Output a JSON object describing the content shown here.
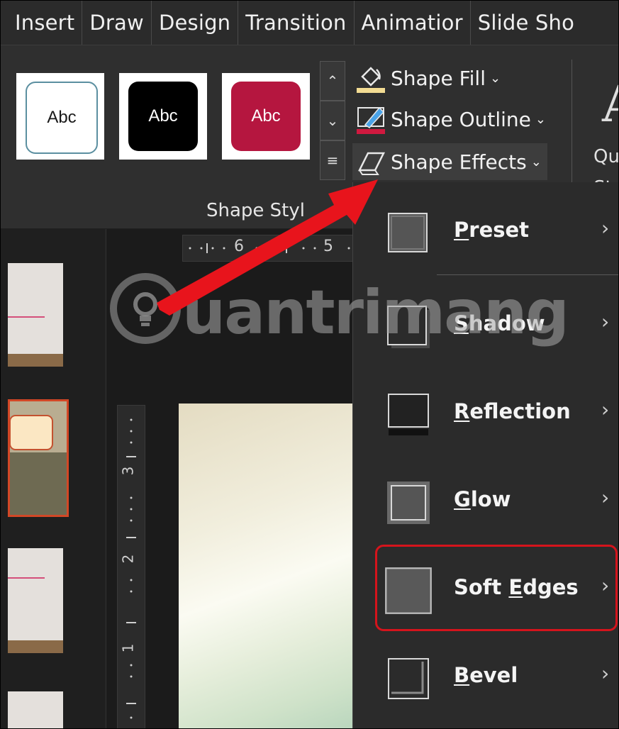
{
  "ribbon": {
    "tabs": [
      "Insert",
      "Draw",
      "Design",
      "Transition",
      "Animatior",
      "Slide Sho"
    ],
    "style_thumbnails": [
      {
        "label": "Abc",
        "fill": "#ffffff",
        "border": "#5b8fa0",
        "text_color": "#1a1a1a"
      },
      {
        "label": "Abc",
        "fill": "#000000",
        "border": "#000000",
        "text_color": "#ffffff"
      },
      {
        "label": "Abc",
        "fill": "#b5163f",
        "border": "#b5163f",
        "text_color": "#ffffff"
      }
    ],
    "shape_fill": "Shape Fill",
    "shape_outline": "Shape Outline",
    "shape_effects": "Shape Effects",
    "group_label": "Shape Styl",
    "quick_styles": {
      "letter": "A",
      "line1": "Qu",
      "line2": "Sty"
    }
  },
  "ruler": {
    "h_ticks": [
      "6",
      "5"
    ],
    "v_ticks": [
      "3",
      "2",
      "1"
    ]
  },
  "effects_menu": {
    "items": [
      {
        "before": "",
        "accel": "P",
        "after": "reset"
      },
      {
        "before": "",
        "accel": "S",
        "after": "hadow"
      },
      {
        "before": "",
        "accel": "R",
        "after": "eflection"
      },
      {
        "before": "",
        "accel": "G",
        "after": "low"
      },
      {
        "before": "Soft ",
        "accel": "E",
        "after": "dges"
      },
      {
        "before": "",
        "accel": "B",
        "after": "evel"
      }
    ],
    "highlighted": "Soft Edges"
  },
  "watermark": "uantrimang",
  "colors": {
    "accent_arrow": "#e8141c",
    "highlight_border": "#d5141c",
    "active_thumb": "#d24726"
  }
}
